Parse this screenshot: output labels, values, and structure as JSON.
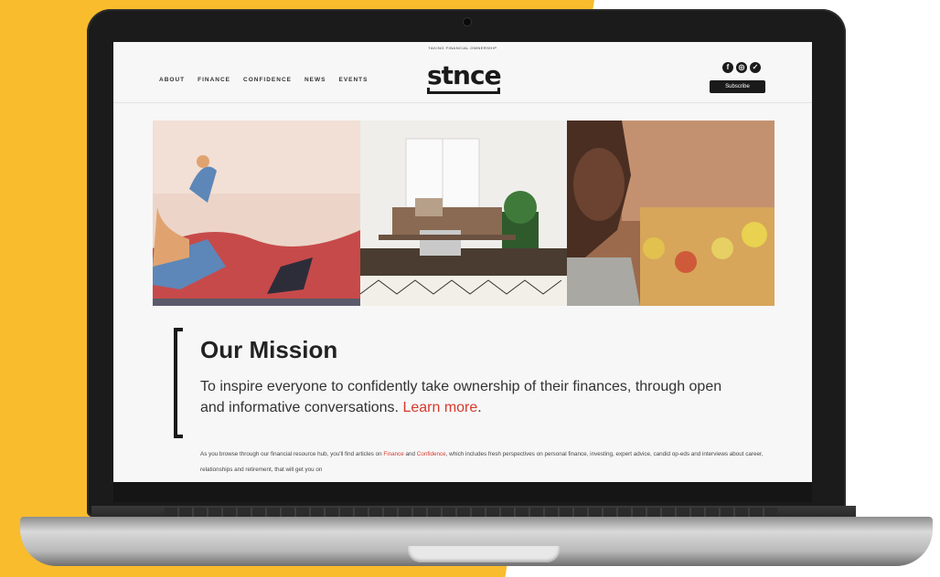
{
  "site": {
    "tagline": "Taking financial ownership",
    "logo_text": "stnce",
    "nav": [
      "ABOUT",
      "FINANCE",
      "CONFIDENCE",
      "NEWS",
      "EVENTS"
    ],
    "subscribe_label": "Subscribe",
    "social_icons": [
      "facebook-icon",
      "instagram-icon",
      "twitter-icon"
    ]
  },
  "mission": {
    "title": "Our Mission",
    "text": "To inspire everyone to confidently take ownership of their finances, through open and informative conversations.",
    "link_text": "Learn more",
    "after_link": "."
  },
  "body": {
    "part1": "As you browse through our financial resource hub, you'll find articles on ",
    "link1": "Finance",
    "part2": " and ",
    "link2": "Confidence",
    "part3": ", which includes fresh perspectives on personal finance, investing, expert advice, candid op-eds and interviews about career, relationships and retirement, that will get you on"
  },
  "colors": {
    "background_yellow": "#f9bc2d",
    "accent_red": "#d6392d",
    "dark": "#1a1a1a"
  }
}
